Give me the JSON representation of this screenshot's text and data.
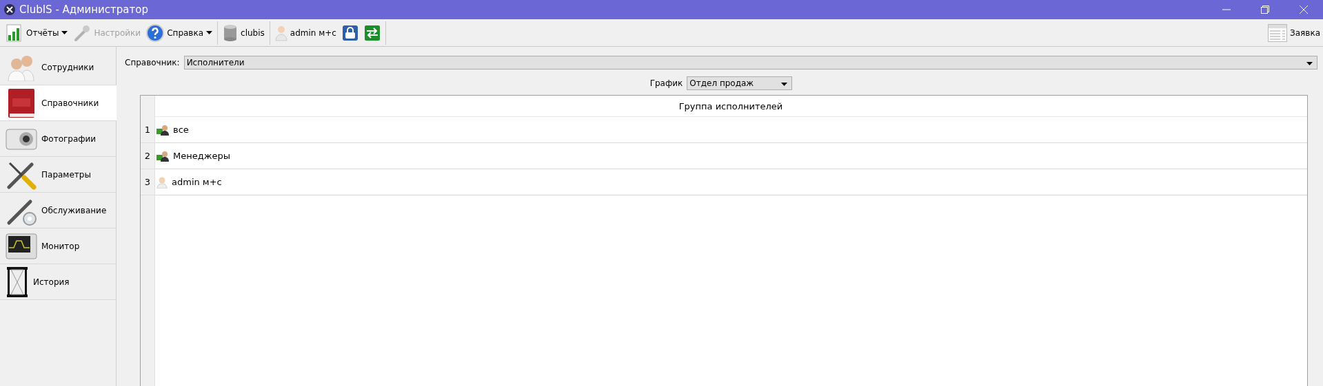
{
  "window": {
    "title": "ClubIS - Администратор"
  },
  "toolbar": [
    {
      "kind": "reports",
      "label": "Отчёты",
      "disabled": false,
      "dropdown": true
    },
    {
      "kind": "settings",
      "label": "Настройки",
      "disabled": true,
      "dropdown": false
    },
    {
      "kind": "help",
      "label": "Справка",
      "disabled": false,
      "dropdown": true
    },
    {
      "kind": "database",
      "label": "clubis",
      "disabled": false,
      "dropdown": false
    },
    {
      "kind": "user",
      "label": "admin м+с",
      "disabled": false,
      "dropdown": false
    },
    {
      "kind": "lock",
      "disabled": false,
      "dropdown": false
    },
    {
      "kind": "switch",
      "disabled": false,
      "dropdown": false
    }
  ],
  "toolbar_right": {
    "label": "Заявка"
  },
  "sidebar": {
    "items": [
      {
        "kind": "staff",
        "label": "Сотрудники",
        "selected": false
      },
      {
        "kind": "book",
        "label": "Справочники",
        "selected": true
      },
      {
        "kind": "camera",
        "label": "Фотографии",
        "selected": false
      },
      {
        "kind": "tools",
        "label": "Параметры",
        "selected": false
      },
      {
        "kind": "service",
        "label": "Обслуживание",
        "selected": false
      },
      {
        "kind": "monitor",
        "label": "Монитор",
        "selected": false
      },
      {
        "kind": "history",
        "label": "История",
        "selected": false
      }
    ]
  },
  "directory": {
    "label": "Справочник:",
    "value": "Исполнители"
  },
  "schedule": {
    "label": "График",
    "value": "Отдел продаж"
  },
  "table": {
    "header": "Группа исполнителей",
    "rows": [
      {
        "number": "1",
        "kind": "group",
        "name": "все"
      },
      {
        "number": "2",
        "kind": "group",
        "name": "Менеджеры"
      },
      {
        "number": "3",
        "kind": "user",
        "name": "admin м+с"
      }
    ]
  }
}
